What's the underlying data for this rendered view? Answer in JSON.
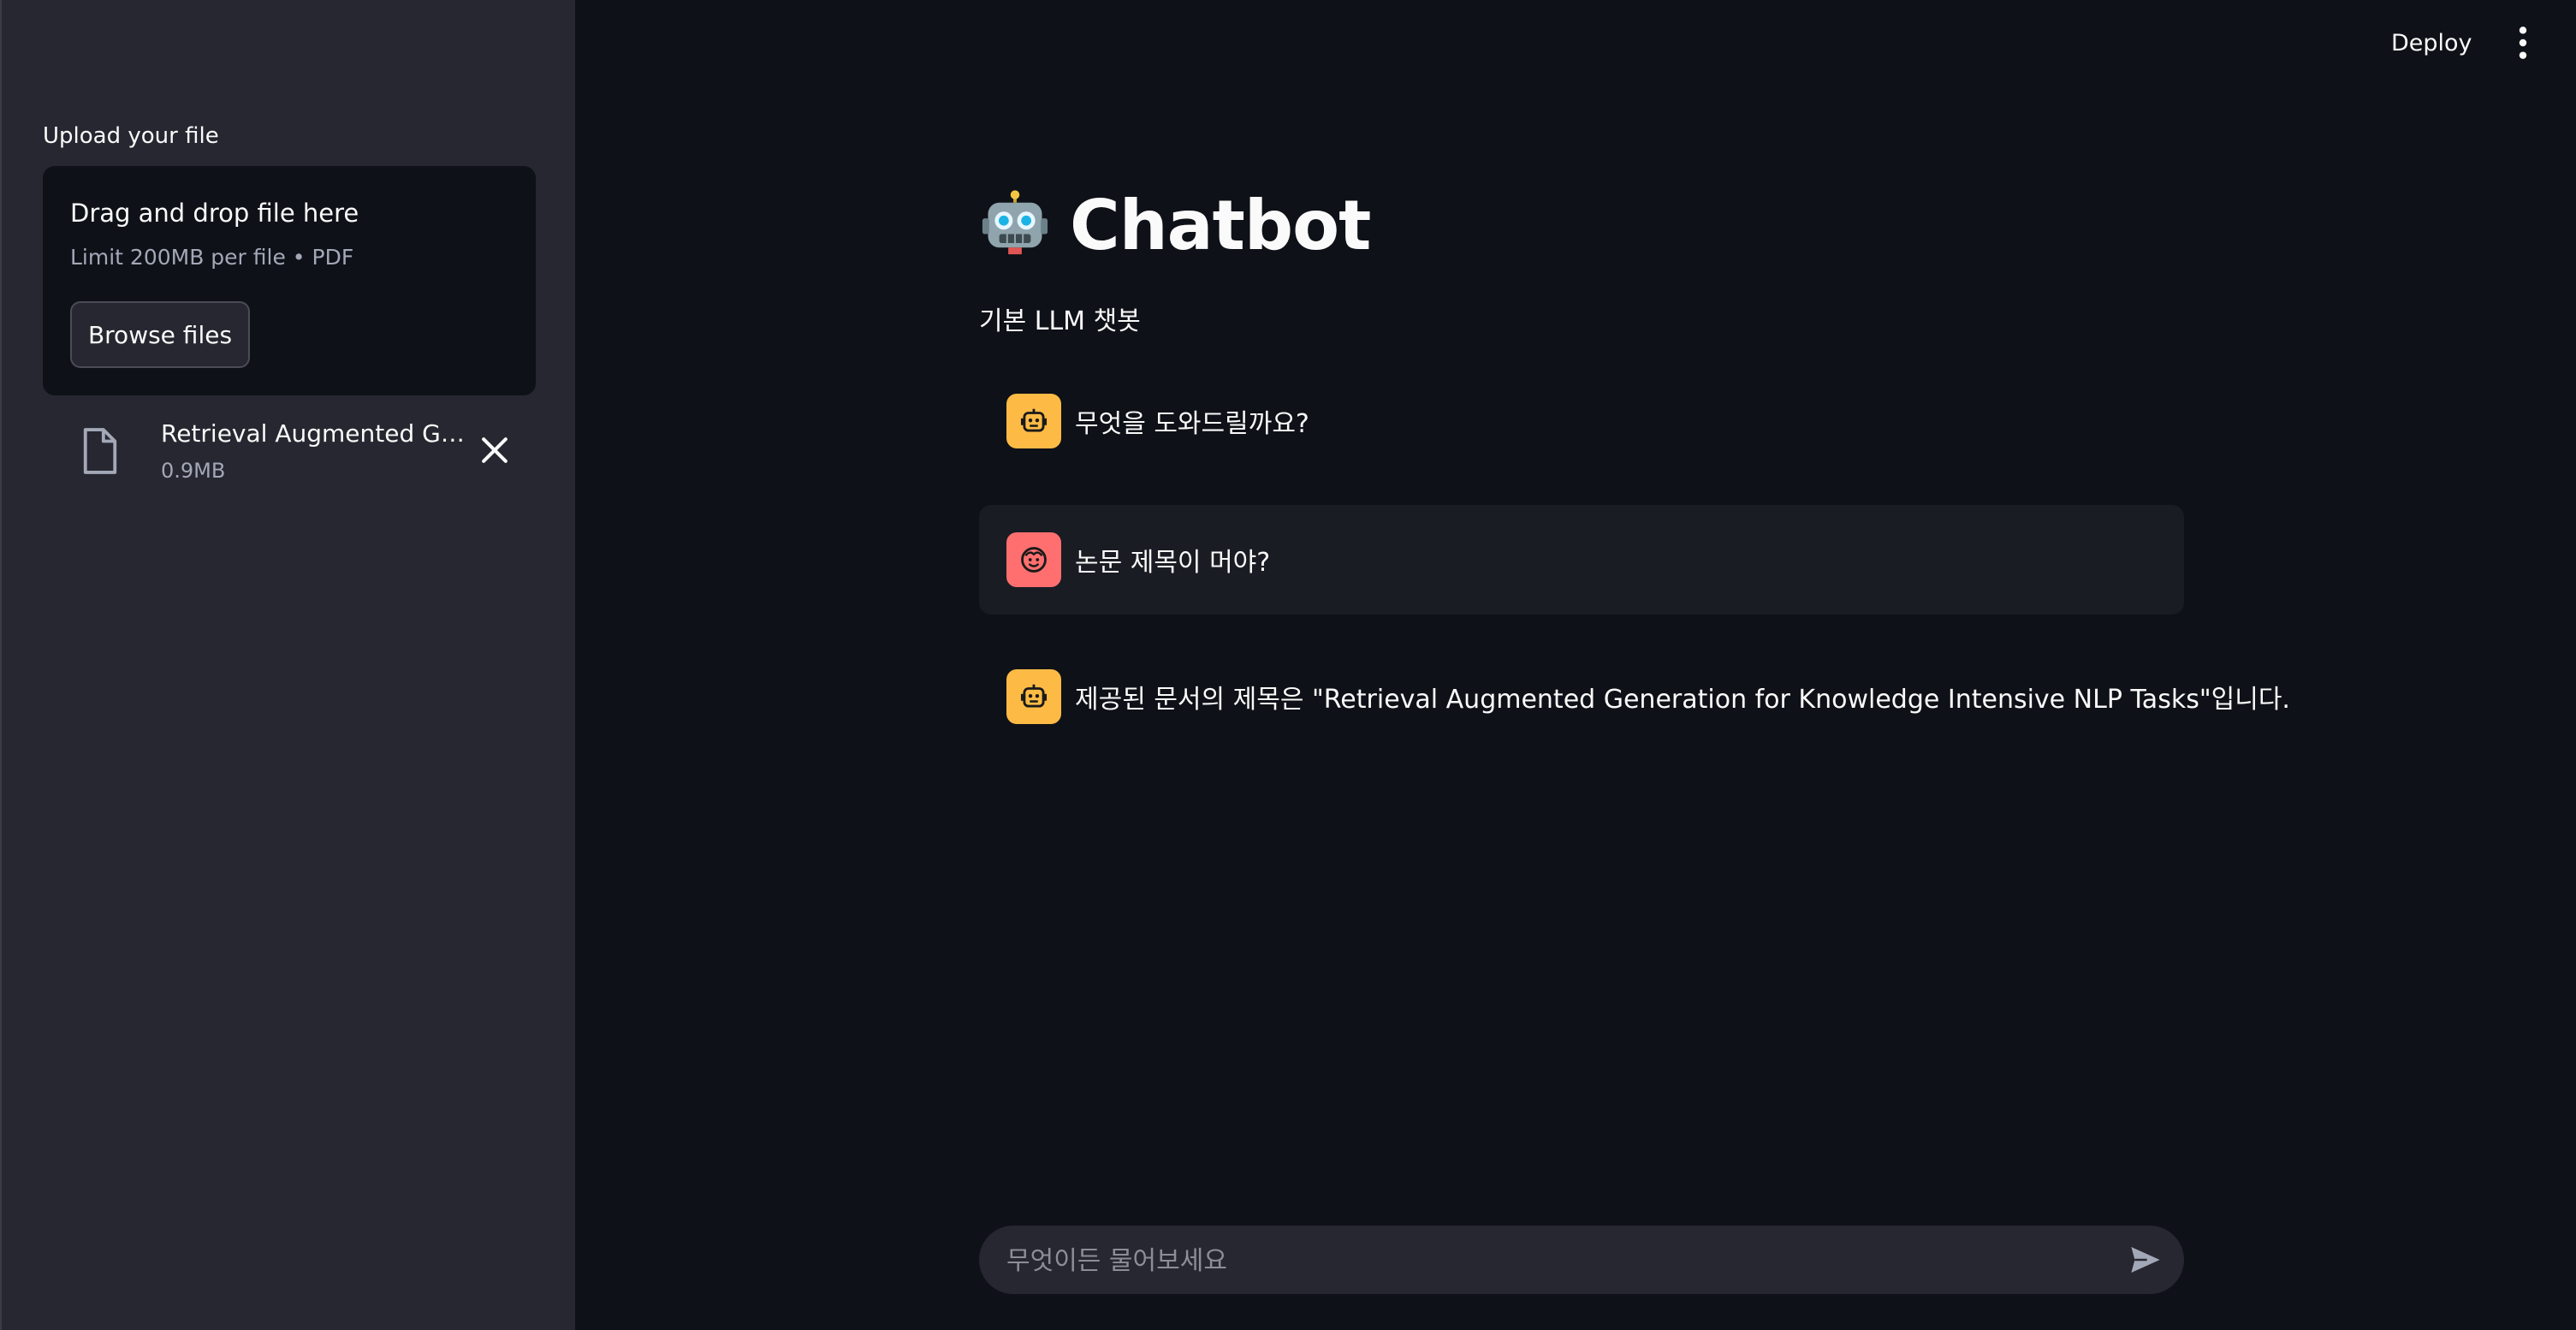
{
  "sidebar": {
    "upload_label": "Upload your file",
    "dropzone": {
      "title": "Drag and drop file here",
      "limit": "Limit 200MB per file • PDF",
      "browse_label": "Browse files"
    },
    "uploaded_file": {
      "name": "Retrieval Augmented Ge…",
      "size": "0.9MB"
    }
  },
  "header": {
    "deploy_label": "Deploy"
  },
  "main": {
    "title": "Chatbot",
    "subtitle": "기본 LLM 챗봇",
    "messages": [
      {
        "role": "assistant",
        "text": "무엇을 도와드릴까요?"
      },
      {
        "role": "user",
        "text": "논문 제목이 머야?"
      },
      {
        "role": "assistant",
        "text": "제공된 문서의 제목은 \"Retrieval Augmented Generation for Knowledge Intensive NLP Tasks\"입니다."
      }
    ],
    "input": {
      "placeholder": "무엇이든 물어보세요"
    }
  },
  "colors": {
    "background": "#0e1117",
    "sidebar": "#262730",
    "bot_avatar": "#fdbb45",
    "user_avatar": "#ff6f6f",
    "user_message_bg": "#1a1c24"
  },
  "icons": {
    "title": "robot-face-icon",
    "file": "document-icon",
    "remove": "close-icon",
    "menu": "more-vertical-icon",
    "bot_avatar": "robot-icon",
    "user_avatar": "smiley-face-icon",
    "send": "send-icon"
  }
}
